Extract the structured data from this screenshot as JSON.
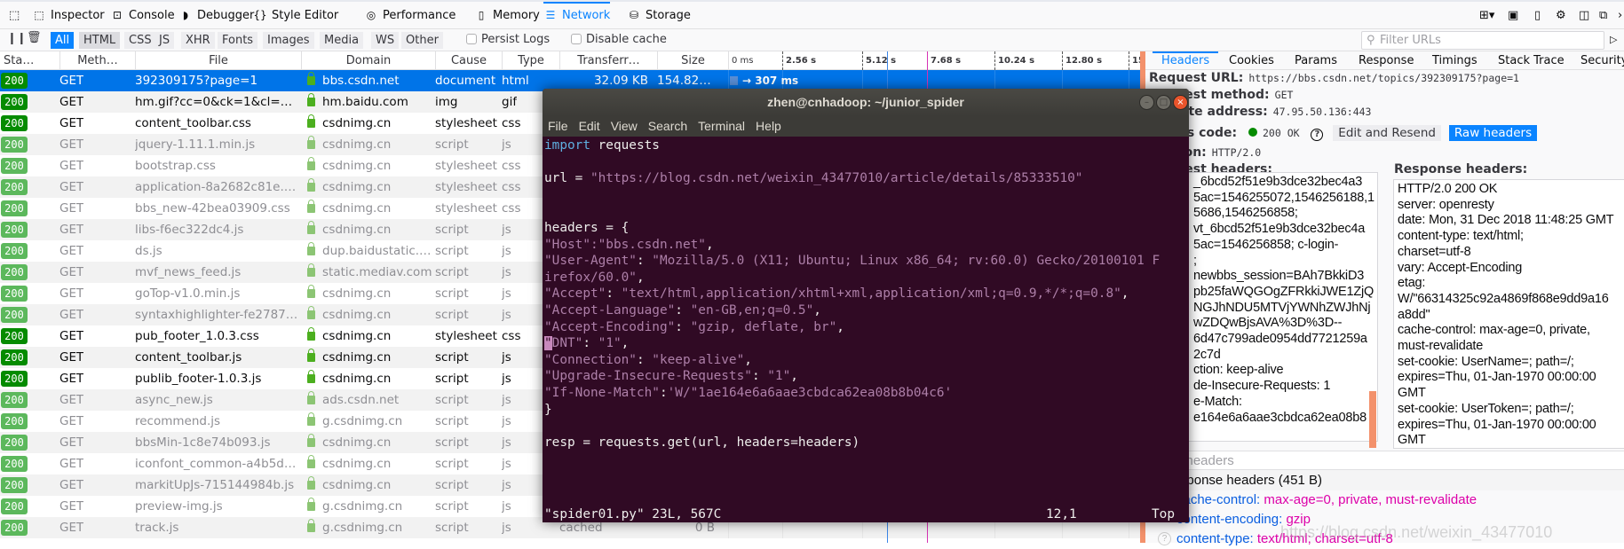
{
  "devtools": {
    "tabs": [
      {
        "label": "Inspector",
        "icon": "inspector-icon"
      },
      {
        "label": "Console",
        "icon": "console-icon"
      },
      {
        "label": "Debugger",
        "icon": "debugger-icon"
      },
      {
        "label": "Style Editor",
        "icon": "style-editor-icon"
      },
      {
        "label": "Performance",
        "icon": "performance-icon"
      },
      {
        "label": "Memory",
        "icon": "memory-icon"
      },
      {
        "label": "Network",
        "icon": "network-icon",
        "active": true
      },
      {
        "label": "Storage",
        "icon": "storage-icon"
      }
    ],
    "filters": [
      "All",
      "HTML",
      "CSS",
      "JS",
      "XHR",
      "Fonts",
      "Images",
      "Media",
      "WS",
      "Other"
    ],
    "active_filter": "All",
    "persist_logs": "Persist Logs",
    "disable_cache": "Disable cache",
    "filter_placeholder": "Filter URLs"
  },
  "columns": [
    "Sta…",
    "Meth…",
    "File",
    "Domain",
    "Cause",
    "Type",
    "Transferr…",
    "Size"
  ],
  "timeline_ticks": [
    "0 ms",
    "2.56 s",
    "5.12 s",
    "7.68 s",
    "10.24 s",
    "12.80 s",
    "15"
  ],
  "requests": [
    {
      "status": "200",
      "method": "GET",
      "file": "392309175?page=1",
      "domain": "bbs.csdn.net",
      "cause": "document",
      "type": "html",
      "transferred": "32.09 KB",
      "size": "154.82 KB",
      "timing": "→ 307 ms",
      "selected": true
    },
    {
      "status": "200",
      "method": "GET",
      "file": "hm.gif?cc=0&ck=1&cl=24-…",
      "domain": "hm.baidu.com",
      "cause": "img",
      "type": "gif"
    },
    {
      "status": "200",
      "method": "GET",
      "file": "content_toolbar.css",
      "domain": "csdnimg.cn",
      "cause": "stylesheet",
      "type": "css"
    },
    {
      "status": "200",
      "method": "GET",
      "file": "jquery-1.11.1.min.js",
      "domain": "csdnimg.cn",
      "cause": "script",
      "type": "js",
      "cached": true
    },
    {
      "status": "200",
      "method": "GET",
      "file": "bootstrap.css",
      "domain": "csdnimg.cn",
      "cause": "stylesheet",
      "type": "css",
      "cached": true
    },
    {
      "status": "200",
      "method": "GET",
      "file": "application-8a2682c81e.css",
      "domain": "csdnimg.cn",
      "cause": "stylesheet",
      "type": "css",
      "cached": true
    },
    {
      "status": "200",
      "method": "GET",
      "file": "bbs_new-42bea03909.css",
      "domain": "csdnimg.cn",
      "cause": "stylesheet",
      "type": "css",
      "cached": true
    },
    {
      "status": "200",
      "method": "GET",
      "file": "libs-f6ec322dc4.js",
      "domain": "csdnimg.cn",
      "cause": "script",
      "type": "js",
      "cached": true
    },
    {
      "status": "200",
      "method": "GET",
      "file": "ds.js",
      "domain": "dup.baidustatic.…",
      "cause": "script",
      "type": "js",
      "cached": true
    },
    {
      "status": "200",
      "method": "GET",
      "file": "mvf_news_feed.js",
      "domain": "static.mediav.com",
      "cause": "script",
      "type": "js",
      "cached": true
    },
    {
      "status": "200",
      "method": "GET",
      "file": "goTop-v1.0.min.js",
      "domain": "csdnimg.cn",
      "cause": "script",
      "type": "js",
      "cached": true
    },
    {
      "status": "200",
      "method": "GET",
      "file": "syntaxhighlighter-fe2787…",
      "domain": "csdnimg.cn",
      "cause": "script",
      "type": "js",
      "cached": true
    },
    {
      "status": "200",
      "method": "GET",
      "file": "pub_footer_1.0.3.css",
      "domain": "csdnimg.cn",
      "cause": "stylesheet",
      "type": "css"
    },
    {
      "status": "200",
      "method": "GET",
      "file": "content_toolbar.js",
      "domain": "csdnimg.cn",
      "cause": "script",
      "type": "js"
    },
    {
      "status": "200",
      "method": "GET",
      "file": "publib_footer-1.0.3.js",
      "domain": "csdnimg.cn",
      "cause": "script",
      "type": "js"
    },
    {
      "status": "200",
      "method": "GET",
      "file": "async_new.js",
      "domain": "ads.csdn.net",
      "cause": "script",
      "type": "js",
      "cached": true
    },
    {
      "status": "200",
      "method": "GET",
      "file": "recommend.js",
      "domain": "g.csdnimg.cn",
      "cause": "script",
      "type": "js",
      "cached": true
    },
    {
      "status": "200",
      "method": "GET",
      "file": "bbsMin-1c8e74b093.js",
      "domain": "csdnimg.cn",
      "cause": "script",
      "type": "js",
      "cached": true
    },
    {
      "status": "200",
      "method": "GET",
      "file": "iconfont_common-a4b5d…",
      "domain": "csdnimg.cn",
      "cause": "script",
      "type": "js",
      "cached": true
    },
    {
      "status": "200",
      "method": "GET",
      "file": "markitUpJs-715144984b.js",
      "domain": "csdnimg.cn",
      "cause": "script",
      "type": "js",
      "cached": true
    },
    {
      "status": "200",
      "method": "GET",
      "file": "preview-img.js",
      "domain": "g.csdnimg.cn",
      "cause": "script",
      "type": "js",
      "cached": true
    },
    {
      "status": "200",
      "method": "GET",
      "file": "track.js",
      "domain": "g.csdnimg.cn",
      "cause": "script",
      "type": "js",
      "cached": true,
      "transferred": "cached",
      "size": "0 B"
    }
  ],
  "side": {
    "tabs": [
      "Headers",
      "Cookies",
      "Params",
      "Response",
      "Timings",
      "Stack Trace",
      "Security"
    ],
    "request_url_label": "Request URL:",
    "request_url": "https://bbs.csdn.net/topics/392309175?page=1",
    "method_label": "Request method:",
    "method": "GET",
    "remote_label": "Remote address:",
    "remote": "47.95.50.136:443",
    "status_label": "Status code:",
    "status": "200 OK",
    "edit_resend": "Edit and Resend",
    "raw_headers": "Raw headers",
    "version_label": "Version:",
    "version": "HTTP/2.0",
    "req_headers_label": "Request headers:",
    "resp_headers_label": "Response headers:",
    "req_headers_lines": [
      "_6bcd52f51e9b3dce32bec4a3",
      "5ac=1546255072,1546256188,1",
      "5686,1546256858;",
      "vt_6bcd52f51e9b3dce32bec4a",
      "5ac=1546256858; c-login-",
      ";",
      "newbbs_session=BAh7BkkiD3",
      "pb25faWQGOgZFRkkiJWE1ZjQ",
      "NGJhNDU5MTVjYWNhZWJhNj",
      "wZDQwBjsAVA%3D%3D--",
      "6d47c799ade0954dd7721259a",
      "2c7d",
      "",
      "ction: keep-alive",
      "de-Insecure-Requests: 1",
      "e-Match:",
      "e164e6a6aae3cbdca62ea08b8"
    ],
    "resp_headers_lines": [
      "HTTP/2.0 200 OK",
      "server: openresty",
      "date: Mon, 31 Dec 2018 11:48:25 GMT",
      "content-type: text/html;",
      "charset=utf-8",
      "vary: Accept-Encoding",
      "etag:",
      "W/\"66314325c92a4869f868e9dd9a16",
      "a8dd\"",
      "cache-control: max-age=0, private,",
      "must-revalidate",
      "set-cookie: UserName=; path=/;",
      "expires=Thu, 01-Jan-1970 00:00:00",
      "GMT",
      "set-cookie: UserToken=; path=/;",
      "expires=Thu, 01-Jan-1970 00:00:00",
      "GMT",
      "content-encoding: gzip"
    ],
    "filter_headers_placeholder": "Filter headers",
    "resp_section": "Response headers (451 B)",
    "resp_list": [
      {
        "key": "cache-control:",
        "value": "max-age=0, private, must-revalidate"
      },
      {
        "key": "content-encoding:",
        "value": "gzip"
      },
      {
        "key": "content-type:",
        "value": "text/html; charset=utf-8"
      }
    ]
  },
  "terminal": {
    "title": "zhen@cnhadoop: ~/junior_spider",
    "menu": [
      "File",
      "Edit",
      "View",
      "Search",
      "Terminal",
      "Help"
    ],
    "lines": [
      [
        [
          "import",
          "k"
        ],
        [
          " requests",
          ""
        ]
      ],
      [],
      [
        [
          "url = ",
          ""
        ],
        [
          "\"https://blog.csdn.net/weixin_43477010/article/details/85333510\"",
          "s"
        ]
      ],
      [],
      [],
      [
        [
          "headers = {",
          ""
        ]
      ],
      [
        [
          "\"Host\":\"bbs.csdn.net\"",
          "s"
        ],
        [
          ",",
          ""
        ]
      ],
      [
        [
          "\"User-Agent\"",
          "s"
        ],
        [
          ": ",
          ""
        ],
        [
          "\"Mozilla/5.0 (X11; Ubuntu; Linux x86_64; rv:60.0) Gecko/20100101 F",
          "s"
        ]
      ],
      [
        [
          "irefox/60.0\"",
          "s"
        ],
        [
          ",",
          ""
        ]
      ],
      [
        [
          "\"Accept\"",
          "s"
        ],
        [
          ": ",
          ""
        ],
        [
          "\"text/html,application/xhtml+xml,application/xml;q=0.9,*/*;q=0.8\"",
          "s"
        ],
        [
          ",",
          ""
        ]
      ],
      [
        [
          "\"Accept-Language\"",
          "s"
        ],
        [
          ": ",
          ""
        ],
        [
          "\"en-GB,en;q=0.5\"",
          "s"
        ],
        [
          ",",
          ""
        ]
      ],
      [
        [
          "\"Accept-Encoding\"",
          "s"
        ],
        [
          ": ",
          ""
        ],
        [
          "\"gzip, deflate, br\"",
          "s"
        ],
        [
          ",",
          ""
        ]
      ],
      [
        [
          "\"",
          "cur"
        ],
        [
          "DNT\"",
          "s"
        ],
        [
          ": ",
          ""
        ],
        [
          "\"1\"",
          "s"
        ],
        [
          ",",
          ""
        ]
      ],
      [
        [
          "\"Connection\"",
          "s"
        ],
        [
          ": ",
          ""
        ],
        [
          "\"keep-alive\"",
          "s"
        ],
        [
          ",",
          ""
        ]
      ],
      [
        [
          "\"Upgrade-Insecure-Requests\"",
          "s"
        ],
        [
          ": ",
          ""
        ],
        [
          "\"1\"",
          "s"
        ],
        [
          ",",
          ""
        ]
      ],
      [
        [
          "\"If-None-Match\"",
          "s"
        ],
        [
          ":",
          ""
        ],
        [
          "'W/\"1ae164e6a6aae3cbdca62ea08b8b04c6'",
          "s"
        ]
      ],
      [
        [
          "}",
          ""
        ]
      ],
      [],
      [
        [
          "resp = requests.get(url, headers=headers)",
          ""
        ]
      ]
    ],
    "status_file": "\"spider01.py\" 23L, 567C",
    "status_pos": "12,1",
    "status_scroll": "Top"
  },
  "watermark": "https://blog.csdn.net/weixin_43477010",
  "colors": {
    "accent": "#0a84ff",
    "selected_row": "#0074e8",
    "status_ok": "#058b00",
    "terminal_bg": "#300a24",
    "splitter": "#f3916b"
  }
}
